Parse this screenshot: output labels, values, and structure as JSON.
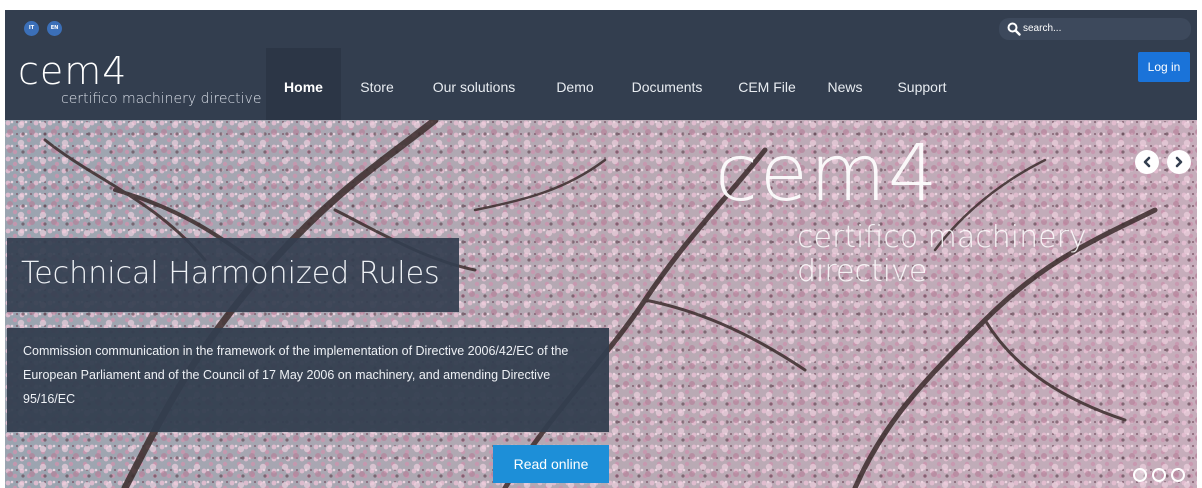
{
  "topbar": {
    "languages": [
      {
        "code": "IT"
      },
      {
        "code": "EN"
      }
    ],
    "search": {
      "placeholder": "search..."
    }
  },
  "header": {
    "logo": {
      "main": "cem4",
      "sub": "certifico machinery directive"
    },
    "nav": [
      {
        "label": "Home",
        "active": true
      },
      {
        "label": "Store"
      },
      {
        "label": "Our solutions"
      },
      {
        "label": "Demo"
      },
      {
        "label": "Documents"
      },
      {
        "label": "CEM File"
      },
      {
        "label": "News"
      },
      {
        "label": "Support"
      }
    ],
    "login_label": "Log in"
  },
  "hero": {
    "watermark": {
      "main": "cem4",
      "sub": "certifico machinery directive"
    },
    "title": "Technical Harmonized Rules",
    "text": "Commission communication in the framework of the implementation of Directive 2006/42/EC of the European Parliament and of the Council of 17 May 2006 on machinery, and amending Directive 95/16/EC",
    "button_label": "Read online",
    "active_slide": 1,
    "slide_count": 3
  },
  "colors": {
    "header_bg": "#333e4f",
    "nav_active_bg": "#2c3646",
    "login_button": "#1a73d9",
    "read_button": "#1d8fd8",
    "blossom": "#d9a8c0"
  },
  "icons": [
    "search-icon",
    "chevron-left-icon",
    "chevron-right-icon"
  ]
}
